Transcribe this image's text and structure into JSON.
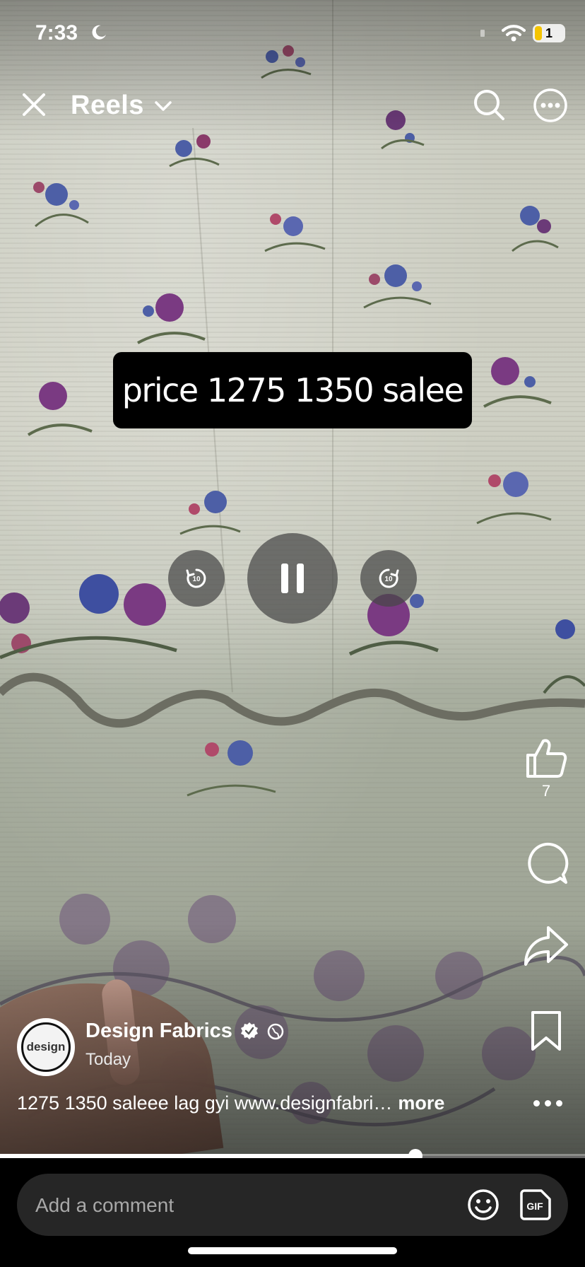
{
  "status_bar": {
    "time": "7:33",
    "battery_level": "1"
  },
  "header": {
    "title": "Reels"
  },
  "video": {
    "overlay_text": "price 1275 1350 salee",
    "playback_state": "playing",
    "progress_fraction": 0.71
  },
  "actions": {
    "like_count": "7"
  },
  "post": {
    "author": "Design Fabrics",
    "avatar_text": "design",
    "date": "Today",
    "caption": "1275 1350 saleee lag gyi www.designfabri…",
    "caption_more": "more"
  },
  "comment": {
    "placeholder": "Add a comment"
  },
  "colors": {
    "bar_bg": "#000000",
    "input_bg": "#262626",
    "battery_fill": "#f4c400"
  }
}
